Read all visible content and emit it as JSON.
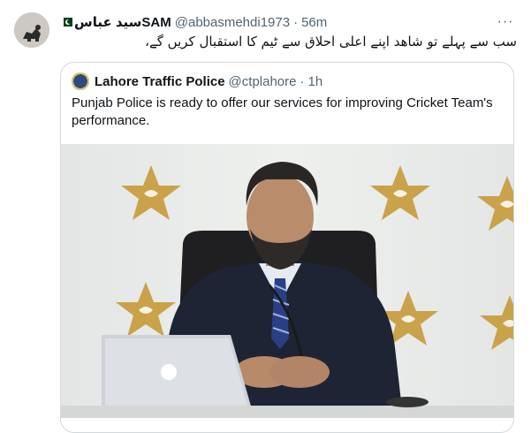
{
  "tweet": {
    "author_name": "سید عباسSAM",
    "handle": "@abbasmehdi1973",
    "separator": "·",
    "time": "56m",
    "more_label": "···",
    "text": "سب سے پہلے تو شاھد اپنے اعلی احلاق سے ٹیم کا استقبال کریں گے،"
  },
  "quote": {
    "author_name": "Lahore Traffic Police",
    "handle": "@ctplahore",
    "separator": "·",
    "time": "1h",
    "text": "Punjab Police is ready to offer our services for improving Cricket Team's performance."
  },
  "colors": {
    "text_primary": "#0f1419",
    "text_secondary": "#536471",
    "border": "#cfd9de",
    "star_gold": "#c9a24a"
  }
}
